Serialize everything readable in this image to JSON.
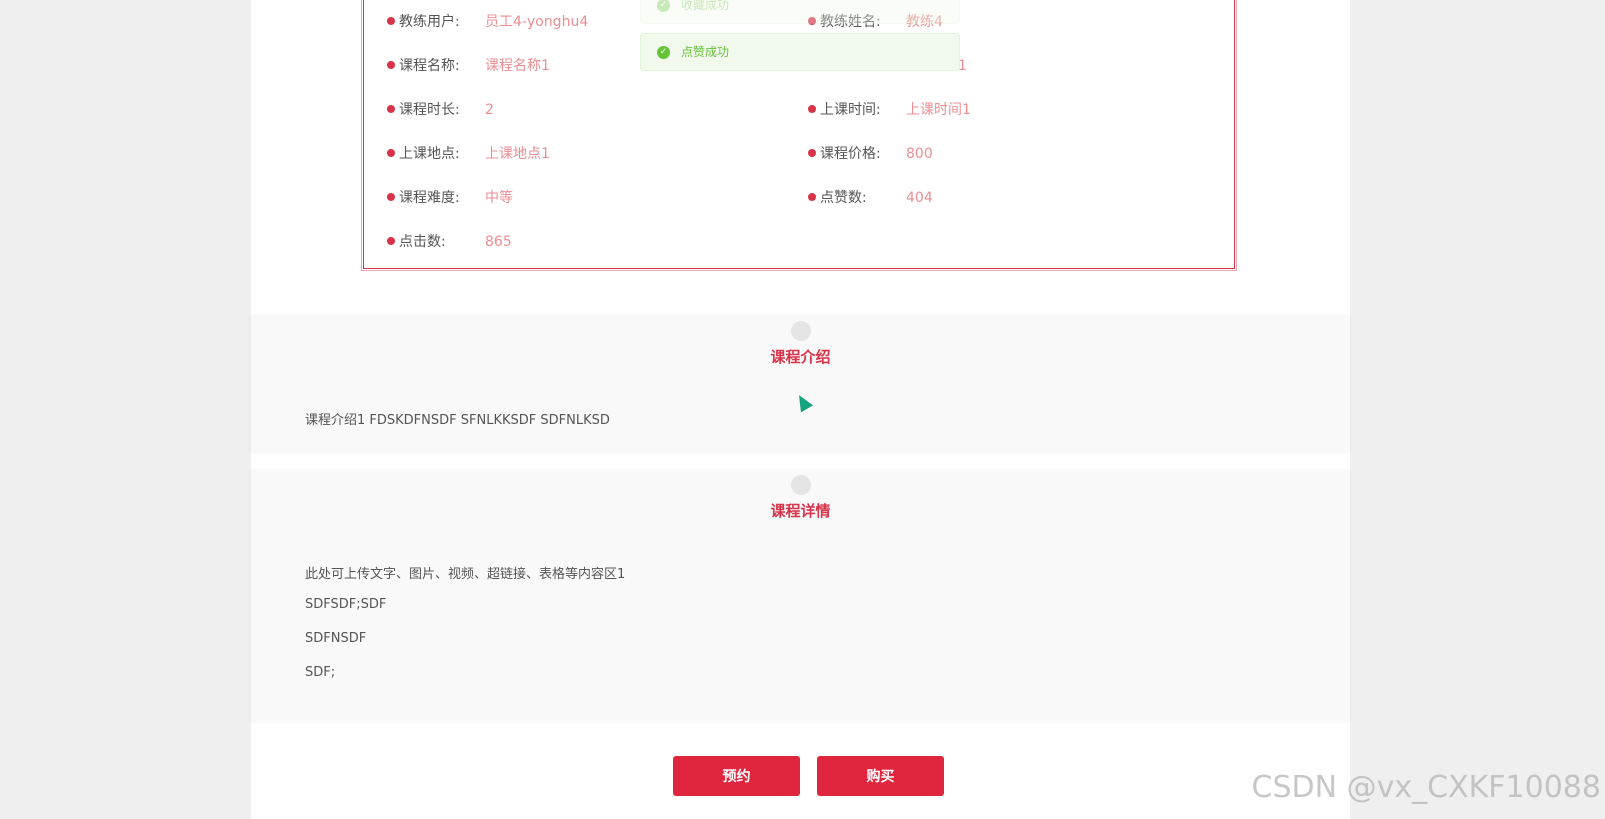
{
  "info": {
    "coach_user": {
      "label": "教练用户:",
      "value": "员工4-yonghu4"
    },
    "coach_name": {
      "label": "教练姓名:",
      "value": "教练4"
    },
    "course_name": {
      "label": "课程名称:",
      "value": "课程名称1"
    },
    "course_name_right_fragment": "1",
    "duration": {
      "label": "课程时长:",
      "value": "2"
    },
    "class_time": {
      "label": "上课时间:",
      "value": "上课时间1"
    },
    "location": {
      "label": "上课地点:",
      "value": "上课地点1"
    },
    "price": {
      "label": "课程价格:",
      "value": "800"
    },
    "difficulty": {
      "label": "课程难度:",
      "value": "中等"
    },
    "likes": {
      "label": "点赞数:",
      "value": "404"
    },
    "clicks": {
      "label": "点击数:",
      "value": "865"
    }
  },
  "toasts": {
    "faded": "收藏成功",
    "main": "点赞成功"
  },
  "intro": {
    "title": "课程介绍",
    "text": "课程介绍1 FDSKDFNSDF SFNLKKSDF SDFNLKSD"
  },
  "detail": {
    "title": "课程详情",
    "lines": [
      "此处可上传文字、图片、视频、超链接、表格等内容区1",
      "SDFSDF;SDF",
      "SDFNSDF",
      "SDF;"
    ]
  },
  "actions": {
    "reserve": "预约",
    "buy": "购买"
  },
  "watermark": "CSDN @vx_CXKF10088"
}
